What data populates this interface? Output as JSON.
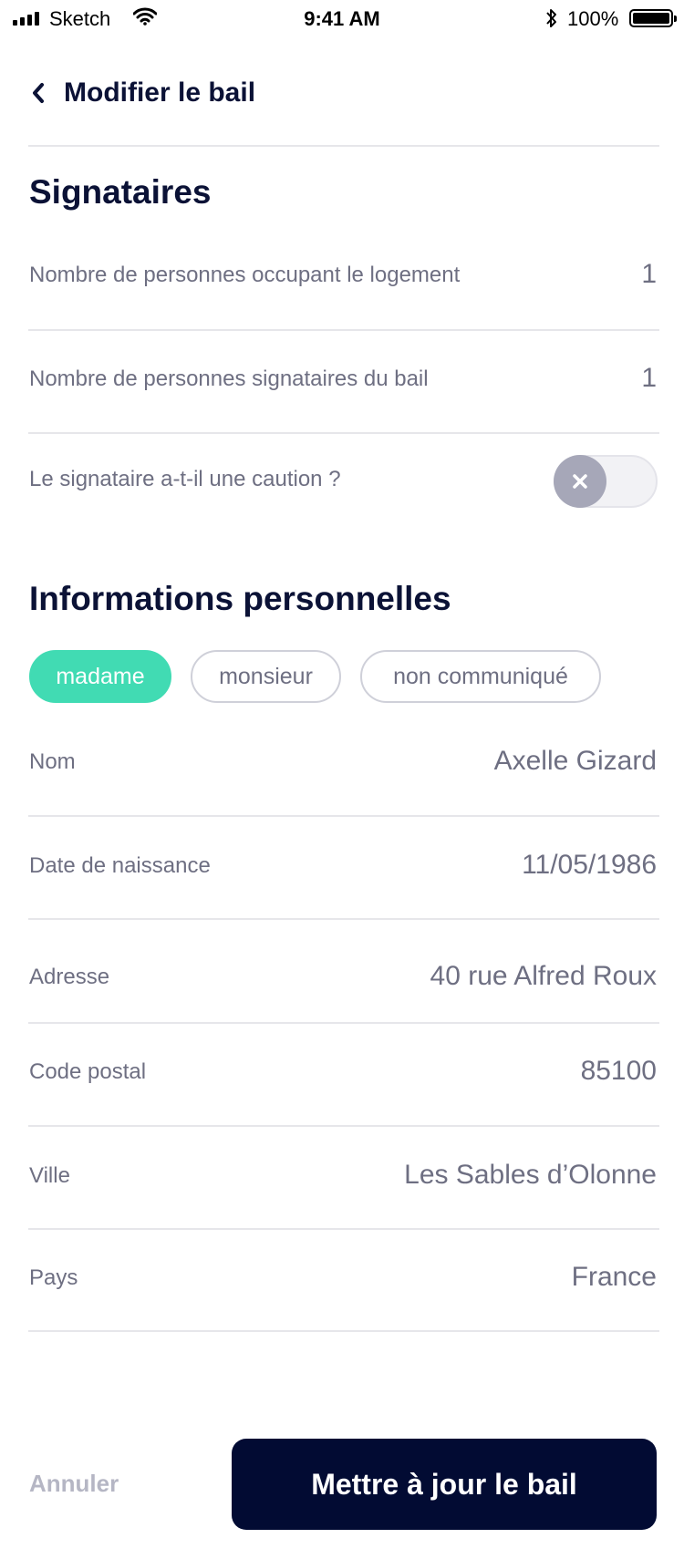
{
  "status_bar": {
    "carrier": "Sketch",
    "time": "9:41 AM",
    "battery_pct": "100%"
  },
  "nav": {
    "back_title": "Modifier le bail"
  },
  "signataires": {
    "title": "Signataires",
    "occupants_label": "Nombre de personnes occupant le logement",
    "occupants_value": "1",
    "signers_label": "Nombre de personnes signataires du bail",
    "signers_value": "1",
    "caution_label": "Le signataire a-t-il une caution ?",
    "caution_enabled": false
  },
  "personal": {
    "title": "Informations personnelles",
    "civility_options": [
      "madame",
      "monsieur",
      "non communiqué"
    ],
    "civility_selected": "madame",
    "fields": [
      {
        "label": "Nom",
        "value": "Axelle Gizard"
      },
      {
        "label": "Date de naissance",
        "value": "11/05/1986"
      },
      {
        "label": "Adresse",
        "value": "40 rue Alfred Roux"
      },
      {
        "label": "Code postal",
        "value": "85100"
      },
      {
        "label": "Ville",
        "value": "Les Sables d’Olonne"
      },
      {
        "label": "Pays",
        "value": "France"
      }
    ]
  },
  "footer": {
    "cancel_label": "Annuler",
    "submit_label": "Mettre à jour le bail"
  },
  "colors": {
    "accent": "#41dbb3",
    "primary_dark": "#020b33",
    "heading": "#0b1236",
    "muted_text": "#6e6f82"
  },
  "icons": [
    "signal-icon",
    "wifi-icon",
    "bluetooth-icon",
    "battery-icon",
    "chevron-left-icon",
    "close-icon"
  ]
}
